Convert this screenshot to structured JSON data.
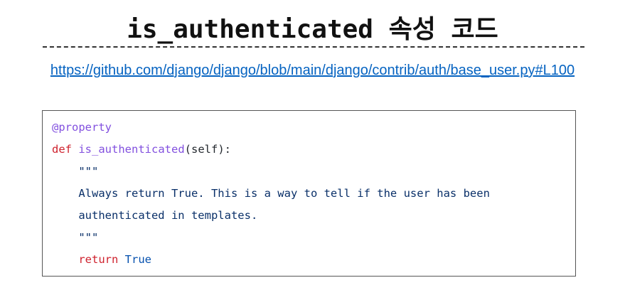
{
  "title": "is_authenticated 속성 코드",
  "link": "https://github.com/django/django/blob/main/django/contrib/auth/base_user.py#L100",
  "code": {
    "decorator": "@property",
    "def_kw": "def",
    "fn_name": "is_authenticated",
    "params": "(self):",
    "doc_open": "\"\"\"",
    "doc_line1": "Always return True. This is a way to tell if the user has been",
    "doc_line2": "authenticated in templates.",
    "doc_close": "\"\"\"",
    "return_kw": "return",
    "return_val": "True"
  }
}
